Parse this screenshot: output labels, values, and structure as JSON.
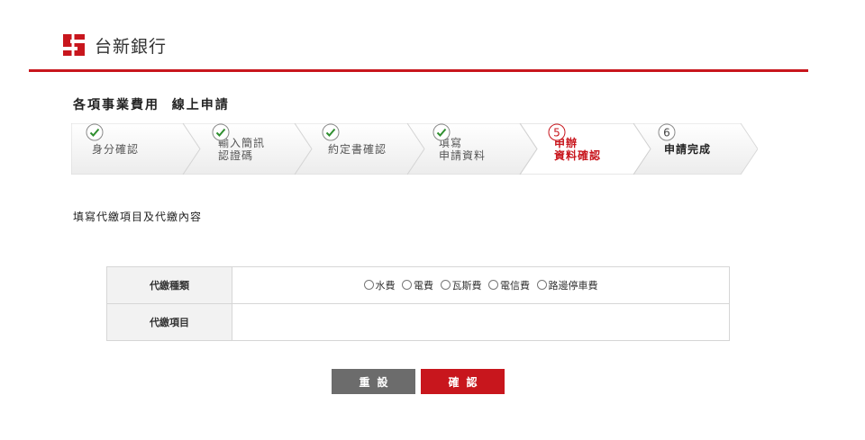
{
  "brand": {
    "name": "台新銀行",
    "color": "#c8161d"
  },
  "page_title": "各項事業費用  線上申請",
  "steps": [
    {
      "icon": "check-circle-icon",
      "lines": [
        "身分確認"
      ],
      "state": "done"
    },
    {
      "icon": "check-circle-icon",
      "lines": [
        "輸入簡訊",
        "認證碼"
      ],
      "state": "done"
    },
    {
      "icon": "check-circle-icon",
      "lines": [
        "約定書確認"
      ],
      "state": "done"
    },
    {
      "icon": "check-circle-icon",
      "lines": [
        "填寫",
        "申請資料"
      ],
      "state": "done"
    },
    {
      "number": "5",
      "lines": [
        "申辦",
        "資料確認"
      ],
      "state": "active"
    },
    {
      "number": "6",
      "lines": [
        "申請完成"
      ],
      "state": "next"
    }
  ],
  "section_title": "填寫代繳項目及代繳內容",
  "form": {
    "type_label": "代繳種類",
    "type_options": [
      "水費",
      "電費",
      "瓦斯費",
      "電信費",
      "路邊停車費"
    ],
    "item_label": "代繳項目",
    "item_value": ""
  },
  "buttons": {
    "reset": "重設",
    "confirm": "確認"
  },
  "colors": {
    "accent": "#c8161d",
    "done_check": "#2f8f2f",
    "reset_button": "#6c6c6c"
  }
}
